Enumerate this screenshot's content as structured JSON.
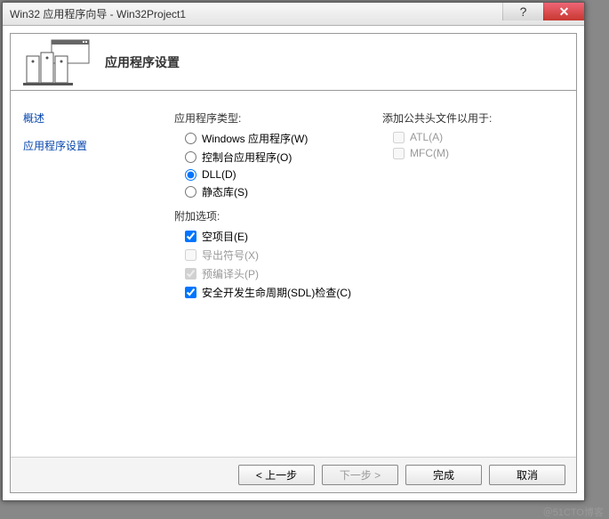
{
  "titlebar": {
    "text": "Win32 应用程序向导 - Win32Project1"
  },
  "header": {
    "title": "应用程序设置"
  },
  "sidebar": {
    "items": [
      {
        "label": "概述"
      },
      {
        "label": "应用程序设置"
      }
    ]
  },
  "appType": {
    "label": "应用程序类型:",
    "options": [
      {
        "label": "Windows 应用程序(W)",
        "checked": false
      },
      {
        "label": "控制台应用程序(O)",
        "checked": false
      },
      {
        "label": "DLL(D)",
        "checked": true
      },
      {
        "label": "静态库(S)",
        "checked": false
      }
    ]
  },
  "addOptions": {
    "label": "附加选项:",
    "options": [
      {
        "label": "空项目(E)",
        "checked": true,
        "disabled": false
      },
      {
        "label": "导出符号(X)",
        "checked": false,
        "disabled": true
      },
      {
        "label": "预编译头(P)",
        "checked": true,
        "disabled": true
      },
      {
        "label": "安全开发生命周期(SDL)检查(C)",
        "checked": true,
        "disabled": false
      }
    ]
  },
  "commonHeaders": {
    "label": "添加公共头文件以用于:",
    "options": [
      {
        "label": "ATL(A)",
        "checked": false,
        "disabled": true
      },
      {
        "label": "MFC(M)",
        "checked": false,
        "disabled": true
      }
    ]
  },
  "footer": {
    "prev": "< 上一步",
    "next": "下一步 >",
    "finish": "完成",
    "cancel": "取消"
  },
  "watermark": "＠51CTO博客"
}
